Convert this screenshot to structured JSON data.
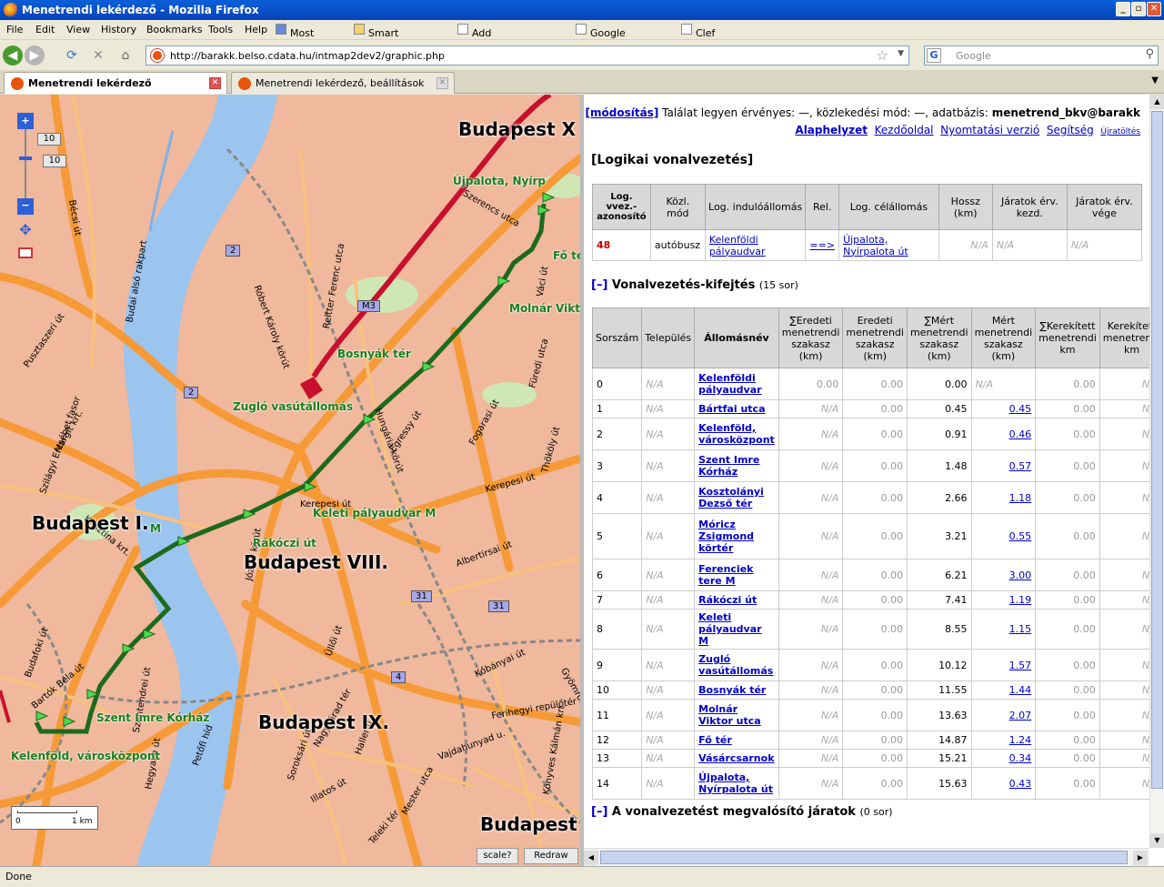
{
  "window": {
    "title": "Menetrendi lekérdező - Mozilla Firefox"
  },
  "menu": [
    "File",
    "Edit",
    "View",
    "History",
    "Bookmarks",
    "Tools",
    "Help"
  ],
  "bookmarks": [
    "Most Visited",
    "Smart Bookmarks",
    "Add Google Bookmark",
    "Google Bookmarks",
    "Clef Reading"
  ],
  "url": "http://barakk.belso.cdata.hu/intmap2dev2/graphic.php",
  "search": {
    "placeholder": "Google"
  },
  "tabs": [
    {
      "label": "Menetrendi lekérdező"
    },
    {
      "label": "Menetrendi lekérdező, beállítások"
    }
  ],
  "map": {
    "zoom_labels": [
      "10",
      "10"
    ],
    "roads": [
      "2",
      "2",
      "M3",
      "31",
      "31",
      "4"
    ],
    "districts": [
      "Budapest X",
      "Budapest I.",
      "Budapest VIII.",
      "Budapest IX.",
      "Budapest"
    ],
    "stations": [
      "Újpalota, Nyírp",
      "Fő té",
      "Molnár Vikto",
      "Bosnyák tér",
      "Zugló vasútállomás",
      "Keleti pályaudvar M",
      "Rákóczi út",
      "Szent Imre Kórház",
      "Kelenföld, városközpont"
    ],
    "m_label": "M",
    "streets": [
      "Bécsi út",
      "Budai alsó rakpart",
      "Pusztaszeri út",
      "Margit krt.",
      "Szilágyi Erzsébet fasor",
      "Krisztina krt.",
      "Róbert Károly körút",
      "Reitter Ferenc utca",
      "Szerencs utca",
      "Hungária körút",
      "Egressy út",
      "Fogarasi út",
      "Kerepesi út",
      "Thököly út",
      "Füredi utca",
      "Albertirsai út",
      "József körút",
      "Üllői út",
      "Ferihegyi repülőtér",
      "Budafoki út",
      "Bartók Béla út",
      "Szentendrei út",
      "Kerepesi út",
      "Könyves Kálmán krt",
      "Gyömrői út",
      "Illatos út",
      "Haller u.",
      "Soroksári út",
      "Hegyalja út",
      "Váci út",
      "Petőfi híd",
      "Nagyvárad tér",
      "Mester utca",
      "Teleki tér",
      "Vajdahunyad u.",
      "Kőbányai út"
    ],
    "scale": {
      "start": "0",
      "end": "1 km"
    },
    "buttons": {
      "scale": "scale?",
      "redraw": "Redraw"
    }
  },
  "panel": {
    "header": {
      "modify": "[módosítás]",
      "info": "Találat legyen érvényes: —, közlekedési mód: —, adatbázis:",
      "db": "menetrend_bkv@barakk",
      "links": [
        "Alaphelyzet",
        "Kezdőoldal",
        "Nyomtatási verzió",
        "Segítség",
        "Újratöltés"
      ]
    },
    "title": "[Logikai vonalvezetés]",
    "logical_table": {
      "headers": [
        "Log. vvez.-azonosító",
        "Közl. mód",
        "Log. indulóállomás",
        "Rel.",
        "Log. célállomás",
        "Hossz (km)",
        "Járatok érv. kezd.",
        "Járatok érv. vége"
      ],
      "row": {
        "id": "48",
        "mode": "autóbusz",
        "from": "Kelenföldi pályaudvar",
        "rel": "==>",
        "to": "Újpalota, Nyírpalota út",
        "length": "N/A",
        "start": "N/A",
        "end": "N/A"
      }
    },
    "section1": {
      "toggle": "[–]",
      "title": "Vonalvezetés-kifejtés",
      "count": "(15 sor)"
    },
    "route_table": {
      "headers": [
        "Sorszám",
        "Település",
        "Állomásnév",
        "∑Eredeti menetrendi szakasz (km)",
        "Eredeti menetrendi szakasz (km)",
        "∑Mért menetrendi szakasz (km)",
        "Mért menetrendi szakasz (km)",
        "∑Kerekített menetrendi km",
        "Kerekített menetrendi km"
      ],
      "rows": [
        {
          "n": "0",
          "town": "N/A",
          "name": "Kelenföldi pályaudvar",
          "sum_orig": "0.00",
          "orig": "0.00",
          "sum_meas": "0.00",
          "meas": "N/A",
          "sum_round": "0.00",
          "round": "N/A"
        },
        {
          "n": "1",
          "town": "N/A",
          "name": "Bártfai utca",
          "sum_orig": "N/A",
          "orig": "0.00",
          "sum_meas": "0.45",
          "meas": "0.45",
          "sum_round": "0.00",
          "round": "N/A"
        },
        {
          "n": "2",
          "town": "N/A",
          "name": "Kelenföld, városközpont",
          "sum_orig": "N/A",
          "orig": "0.00",
          "sum_meas": "0.91",
          "meas": "0.46",
          "sum_round": "0.00",
          "round": "N/A"
        },
        {
          "n": "3",
          "town": "N/A",
          "name": "Szent Imre Kórház",
          "sum_orig": "N/A",
          "orig": "0.00",
          "sum_meas": "1.48",
          "meas": "0.57",
          "sum_round": "0.00",
          "round": "N/A"
        },
        {
          "n": "4",
          "town": "N/A",
          "name": "Kosztolányi Dezső tér",
          "sum_orig": "N/A",
          "orig": "0.00",
          "sum_meas": "2.66",
          "meas": "1.18",
          "sum_round": "0.00",
          "round": "N/A"
        },
        {
          "n": "5",
          "town": "N/A",
          "name": "Móricz Zsigmond körtér",
          "sum_orig": "N/A",
          "orig": "0.00",
          "sum_meas": "3.21",
          "meas": "0.55",
          "sum_round": "0.00",
          "round": "N/A"
        },
        {
          "n": "6",
          "town": "N/A",
          "name": "Ferenciek tere M",
          "sum_orig": "N/A",
          "orig": "0.00",
          "sum_meas": "6.21",
          "meas": "3.00",
          "sum_round": "0.00",
          "round": "N/A"
        },
        {
          "n": "7",
          "town": "N/A",
          "name": "Rákóczi út",
          "sum_orig": "N/A",
          "orig": "0.00",
          "sum_meas": "7.41",
          "meas": "1.19",
          "sum_round": "0.00",
          "round": "N/A"
        },
        {
          "n": "8",
          "town": "N/A",
          "name": "Keleti pályaudvar M",
          "sum_orig": "N/A",
          "orig": "0.00",
          "sum_meas": "8.55",
          "meas": "1.15",
          "sum_round": "0.00",
          "round": "N/A"
        },
        {
          "n": "9",
          "town": "N/A",
          "name": "Zugló vasútállomás",
          "sum_orig": "N/A",
          "orig": "0.00",
          "sum_meas": "10.12",
          "meas": "1.57",
          "sum_round": "0.00",
          "round": "N/A"
        },
        {
          "n": "10",
          "town": "N/A",
          "name": "Bosnyák tér",
          "sum_orig": "N/A",
          "orig": "0.00",
          "sum_meas": "11.55",
          "meas": "1.44",
          "sum_round": "0.00",
          "round": "N/A"
        },
        {
          "n": "11",
          "town": "N/A",
          "name": "Molnár Viktor utca",
          "sum_orig": "N/A",
          "orig": "0.00",
          "sum_meas": "13.63",
          "meas": "2.07",
          "sum_round": "0.00",
          "round": "N/A"
        },
        {
          "n": "12",
          "town": "N/A",
          "name": "Fő tér",
          "sum_orig": "N/A",
          "orig": "0.00",
          "sum_meas": "14.87",
          "meas": "1.24",
          "sum_round": "0.00",
          "round": "N/A"
        },
        {
          "n": "13",
          "town": "N/A",
          "name": "Vásárcsarnok",
          "sum_orig": "N/A",
          "orig": "0.00",
          "sum_meas": "15.21",
          "meas": "0.34",
          "sum_round": "0.00",
          "round": "N/A"
        },
        {
          "n": "14",
          "town": "N/A",
          "name": "Újpalota, Nyírpalota út",
          "sum_orig": "N/A",
          "orig": "0.00",
          "sum_meas": "15.63",
          "meas": "0.43",
          "sum_round": "0.00",
          "round": "N/A"
        }
      ]
    },
    "section2": {
      "toggle": "[–]",
      "title": "A vonalvezetést megvalósító járatok",
      "count": "(0 sor)"
    }
  },
  "status": "Done"
}
